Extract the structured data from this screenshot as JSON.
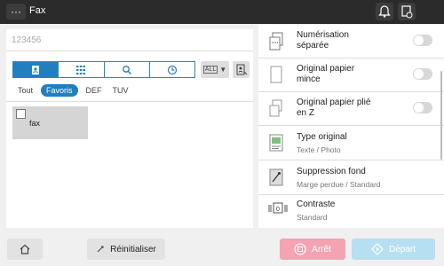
{
  "topbar": {
    "title": "Fax",
    "menu_icon": "more-icon",
    "notification_icon": "bell-icon",
    "status_icon": "device-status-icon"
  },
  "destination": {
    "value": "123456"
  },
  "search_modes": [
    "address-book-icon",
    "keypad-icon",
    "search-icon",
    "history-icon"
  ],
  "index_select": "ALL",
  "filters": [
    "Tout",
    "Favoris",
    "DEF",
    "TUV"
  ],
  "active_filter": "Favoris",
  "address_entries": [
    {
      "label": "fax"
    }
  ],
  "settings": [
    {
      "line1": "Numérisation",
      "line2": "séparée",
      "toggle": false
    },
    {
      "line1": "Original papier",
      "line2": "mince",
      "toggle": false
    },
    {
      "line1": "Original papier plié",
      "line2": "en Z",
      "toggle": false
    },
    {
      "title": "Type original",
      "value": "Texte / Photo"
    },
    {
      "title": "Suppression fond",
      "value": "Marge perdue / Standard"
    },
    {
      "title": "Contraste",
      "value": "Standard"
    }
  ],
  "bottom": {
    "reset": "Réinitialiser",
    "stop": "Arrêt",
    "start": "Départ"
  },
  "colors": {
    "accent": "#1f7fbf",
    "stop": "#f4a3b3",
    "start": "#b7dff2",
    "topbar": "#2b2b2b"
  }
}
